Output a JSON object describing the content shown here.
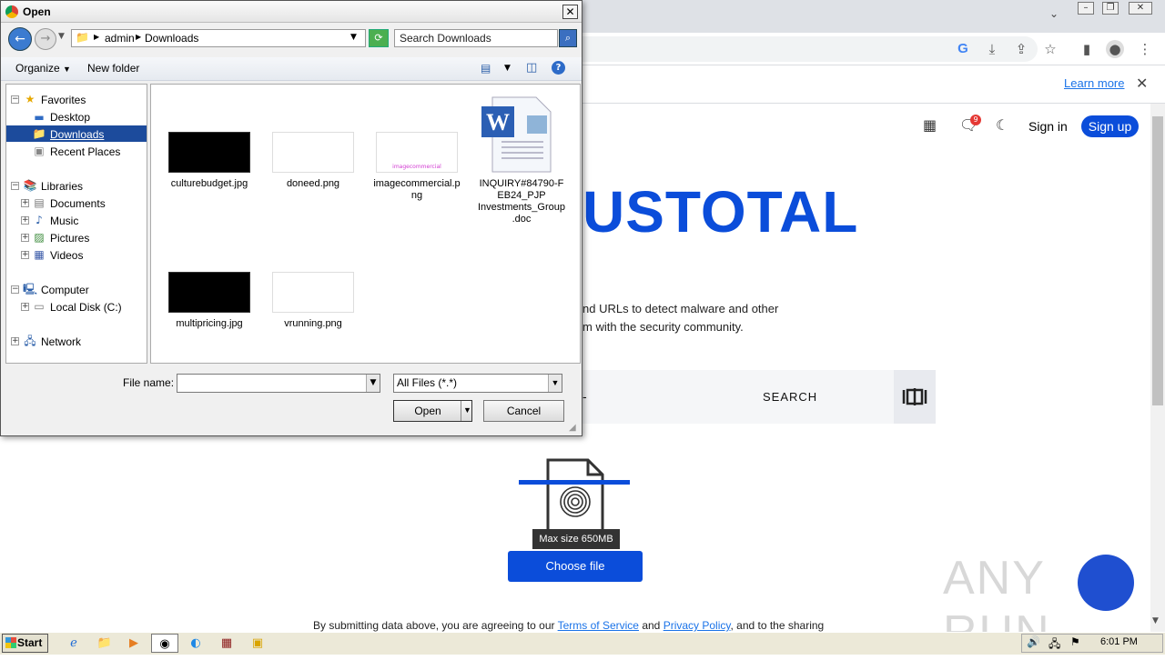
{
  "browser": {
    "toolbar_icons": [
      "google-icon",
      "download-icon",
      "share-icon",
      "star-icon",
      "sidepanel-icon",
      "profile-icon",
      "more-icon"
    ],
    "infobar": {
      "learn_more": "Learn more"
    },
    "nav": {
      "sign_in": "Sign in",
      "sign_up": "Sign up",
      "notifications_count": "9"
    },
    "logo_text": "USTOTAL",
    "description_line1": "nd URLs to detect malware and other",
    "description_line2": "m with the security community.",
    "search_button": "SEARCH",
    "search_dash": "-",
    "tooltip": "Max size 650MB",
    "choose_file": "Choose file",
    "footer": {
      "prefix": "By submitting data above, you are agreeing to our ",
      "terms": "Terms of Service",
      "and": " and ",
      "privacy": "Privacy Policy",
      "suffix": ", and to the sharing"
    },
    "watermark": "ANY RUN",
    "accent_color": "#0b4dda"
  },
  "dialog": {
    "title": "Open",
    "breadcrumb": [
      "admin",
      "Downloads"
    ],
    "search_placeholder": "Search Downloads",
    "organize": "Organize",
    "new_folder": "New folder",
    "tree": {
      "favorites": "Favorites",
      "desktop": "Desktop",
      "downloads": "Downloads",
      "recent_places": "Recent Places",
      "libraries": "Libraries",
      "documents": "Documents",
      "music": "Music",
      "pictures": "Pictures",
      "videos": "Videos",
      "computer": "Computer",
      "local_disk": "Local Disk (C:)",
      "network": "Network"
    },
    "files": [
      {
        "name": "culturebudget.jpg",
        "thumb": "black"
      },
      {
        "name": "doneed.png",
        "thumb": "white"
      },
      {
        "name1": "imagecommercial.p",
        "name2": "ng",
        "thumb": "white-pink",
        "thumb_text": "imagecommercial"
      },
      {
        "name1": "INQUIRY#84790-F",
        "name2": "EB24_PJP",
        "name3": "Investments_Group",
        "name4": ".doc",
        "thumb": "word"
      },
      {
        "name": "multipricing.jpg",
        "thumb": "black"
      },
      {
        "name": "vrunning.png",
        "thumb": "white"
      }
    ],
    "file_name_label": "File name:",
    "file_name_value": "",
    "file_type": "All Files (*.*)",
    "open": "Open",
    "cancel": "Cancel"
  },
  "taskbar": {
    "start": "Start",
    "clock": "6:01 PM"
  }
}
